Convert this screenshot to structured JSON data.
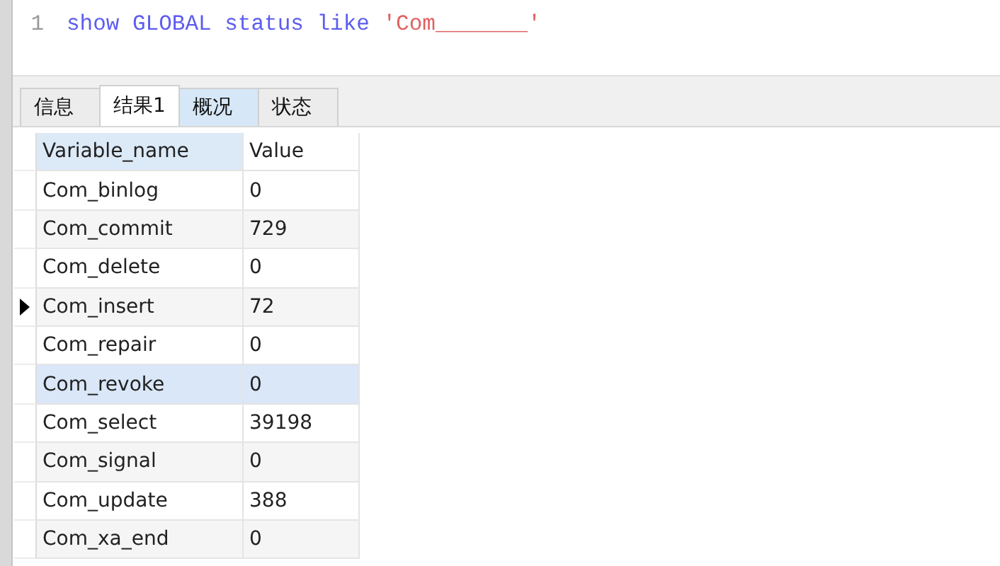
{
  "editor": {
    "lines": [
      {
        "number": "1",
        "tokens": [
          {
            "kind": "keyword",
            "text": "show GLOBAL status like "
          },
          {
            "kind": "string",
            "text": "'Com_______'"
          }
        ]
      }
    ]
  },
  "tabs": [
    {
      "label": "信息",
      "selected": false,
      "hover": false
    },
    {
      "label": "结果1",
      "selected": true,
      "hover": false
    },
    {
      "label": "概况",
      "selected": false,
      "hover": true
    },
    {
      "label": "状态",
      "selected": false,
      "hover": false
    }
  ],
  "table": {
    "columns": [
      "Variable_name",
      "Value"
    ],
    "rows": [
      {
        "cells": [
          "Com_binlog",
          "0"
        ],
        "current": false,
        "highlighted": false
      },
      {
        "cells": [
          "Com_commit",
          "729"
        ],
        "current": false,
        "highlighted": false
      },
      {
        "cells": [
          "Com_delete",
          "0"
        ],
        "current": false,
        "highlighted": false
      },
      {
        "cells": [
          "Com_insert",
          "72"
        ],
        "current": true,
        "highlighted": false
      },
      {
        "cells": [
          "Com_repair",
          "0"
        ],
        "current": false,
        "highlighted": false
      },
      {
        "cells": [
          "Com_revoke",
          "0"
        ],
        "current": false,
        "highlighted": true
      },
      {
        "cells": [
          "Com_select",
          "39198"
        ],
        "current": false,
        "highlighted": false
      },
      {
        "cells": [
          "Com_signal",
          "0"
        ],
        "current": false,
        "highlighted": false
      },
      {
        "cells": [
          "Com_update",
          "388"
        ],
        "current": false,
        "highlighted": false
      },
      {
        "cells": [
          "Com_xa_end",
          "0"
        ],
        "current": false,
        "highlighted": false
      }
    ]
  }
}
